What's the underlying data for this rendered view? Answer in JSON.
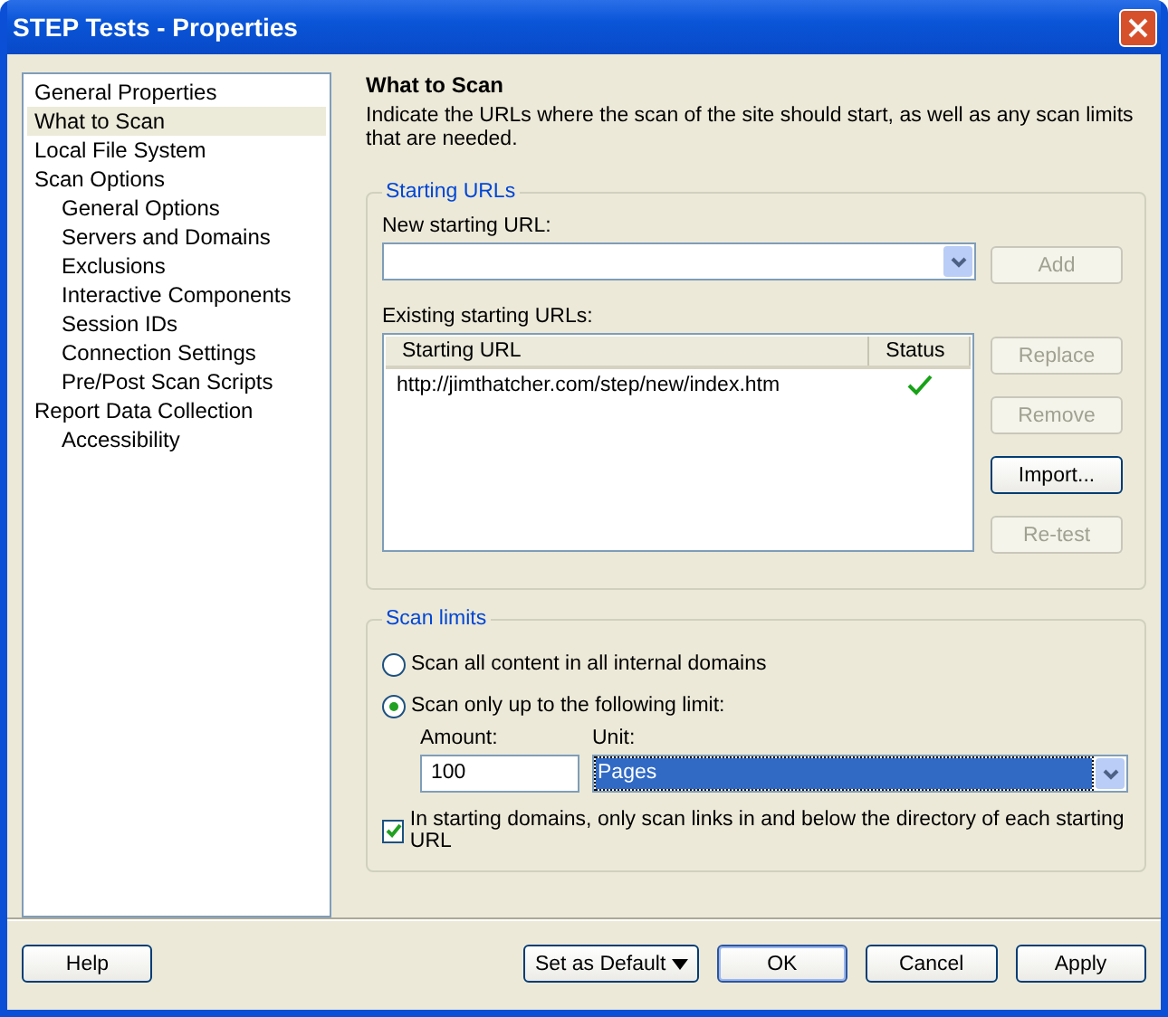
{
  "window": {
    "title": "STEP Tests - Properties"
  },
  "nav": [
    {
      "label": "General Properties",
      "selected": false
    },
    {
      "label": "What to Scan",
      "selected": true
    },
    {
      "label": "Local File System",
      "selected": false
    },
    {
      "label": "Scan Options",
      "selected": false,
      "children": [
        {
          "label": "General Options",
          "selected": false
        },
        {
          "label": "Servers and Domains",
          "selected": false
        },
        {
          "label": "Exclusions",
          "selected": false
        },
        {
          "label": "Interactive Components",
          "selected": false
        },
        {
          "label": "Session IDs",
          "selected": false
        },
        {
          "label": "Connection Settings",
          "selected": false
        },
        {
          "label": "Pre/Post Scan Scripts",
          "selected": false
        }
      ]
    },
    {
      "label": "Report Data Collection",
      "selected": false,
      "children": [
        {
          "label": "Accessibility",
          "selected": false
        }
      ]
    }
  ],
  "page": {
    "title": "What to Scan",
    "description": "Indicate the URLs where the scan of the site should start, as well as any scan limits that are needed."
  },
  "starting_urls": {
    "legend": "Starting URLs",
    "new_url_label": "New starting URL:",
    "add_button": {
      "label": "Add",
      "disabled": true
    },
    "existing_label": "Existing starting URLs:",
    "table": {
      "columns": [
        "Starting URL",
        "Status"
      ],
      "rows": [
        {
          "url": "http://jimthatcher.com/step/new/index.htm",
          "ok": true
        }
      ]
    },
    "buttons": [
      {
        "label": "Replace",
        "disabled": true
      },
      {
        "label": "Remove",
        "disabled": true
      },
      {
        "label": "Import...",
        "disabled": false
      },
      {
        "label": "Re-test",
        "disabled": true
      }
    ]
  },
  "scan_limits": {
    "legend": "Scan limits",
    "options": [
      {
        "label": "Scan all content in all internal domains",
        "selected": false
      },
      {
        "label": "Scan only up to the following limit:",
        "selected": true
      }
    ],
    "amount_label": "Amount:",
    "amount": "100",
    "unit_label": "Unit:",
    "unit": "Pages",
    "directory_only": {
      "label": "In starting domains, only scan links in and below the directory of each starting URL",
      "checked": true
    }
  },
  "footer_buttons": [
    {
      "label": "Help",
      "kind": "normal"
    },
    {
      "label": "Set as Default",
      "kind": "menu"
    },
    {
      "label": "OK",
      "kind": "default"
    },
    {
      "label": "Cancel",
      "kind": "normal"
    },
    {
      "label": "Apply",
      "kind": "normal"
    }
  ]
}
